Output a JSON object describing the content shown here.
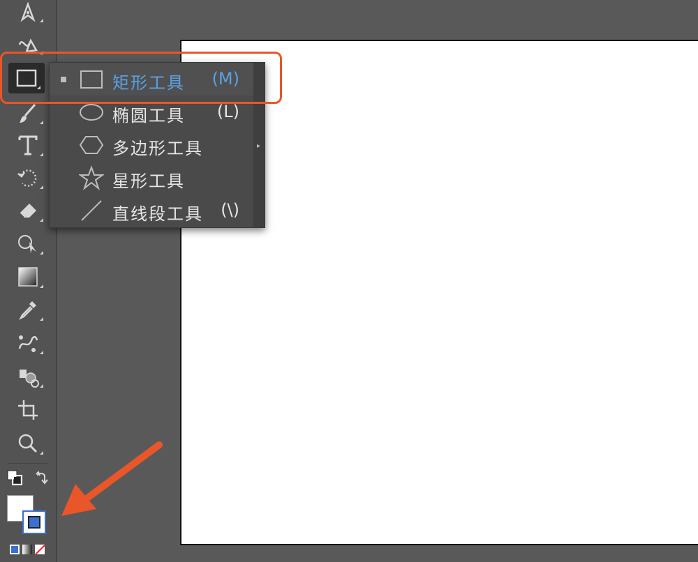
{
  "toolbar": {
    "tools": [
      {
        "name": "pen-tool-icon"
      },
      {
        "name": "curvature-tool-icon"
      },
      {
        "name": "rectangle-tool-icon"
      },
      {
        "name": "paintbrush-tool-icon"
      },
      {
        "name": "type-tool-icon",
        "glyph": "T"
      },
      {
        "name": "rotate-tool-icon"
      },
      {
        "name": "eraser-tool-icon"
      },
      {
        "name": "puppet-warp-tool-icon"
      },
      {
        "name": "gradient-tool-icon"
      },
      {
        "name": "eyedropper-tool-icon"
      },
      {
        "name": "blend-tool-icon"
      },
      {
        "name": "symbol-sprayer-tool-icon"
      },
      {
        "name": "artboard-tool-icon"
      },
      {
        "name": "zoom-tool-icon"
      }
    ]
  },
  "flyout": {
    "items": [
      {
        "label": "矩形工具",
        "shortcut": "(M)",
        "icon": "rectangle-icon",
        "selected": true
      },
      {
        "label": "椭圆工具",
        "shortcut": "(L)",
        "icon": "ellipse-icon",
        "selected": false
      },
      {
        "label": "多边形工具",
        "shortcut": "",
        "icon": "polygon-icon",
        "selected": false
      },
      {
        "label": "星形工具",
        "shortcut": "",
        "icon": "star-icon",
        "selected": false
      },
      {
        "label": "直线段工具",
        "shortcut": "(\\)",
        "icon": "line-segment-icon",
        "selected": false
      }
    ]
  },
  "colors": {
    "accent": "#5aa1e3",
    "annotation": "#e8562a",
    "panel": "#535353",
    "stroke_swatch": "#3a6fd3"
  }
}
